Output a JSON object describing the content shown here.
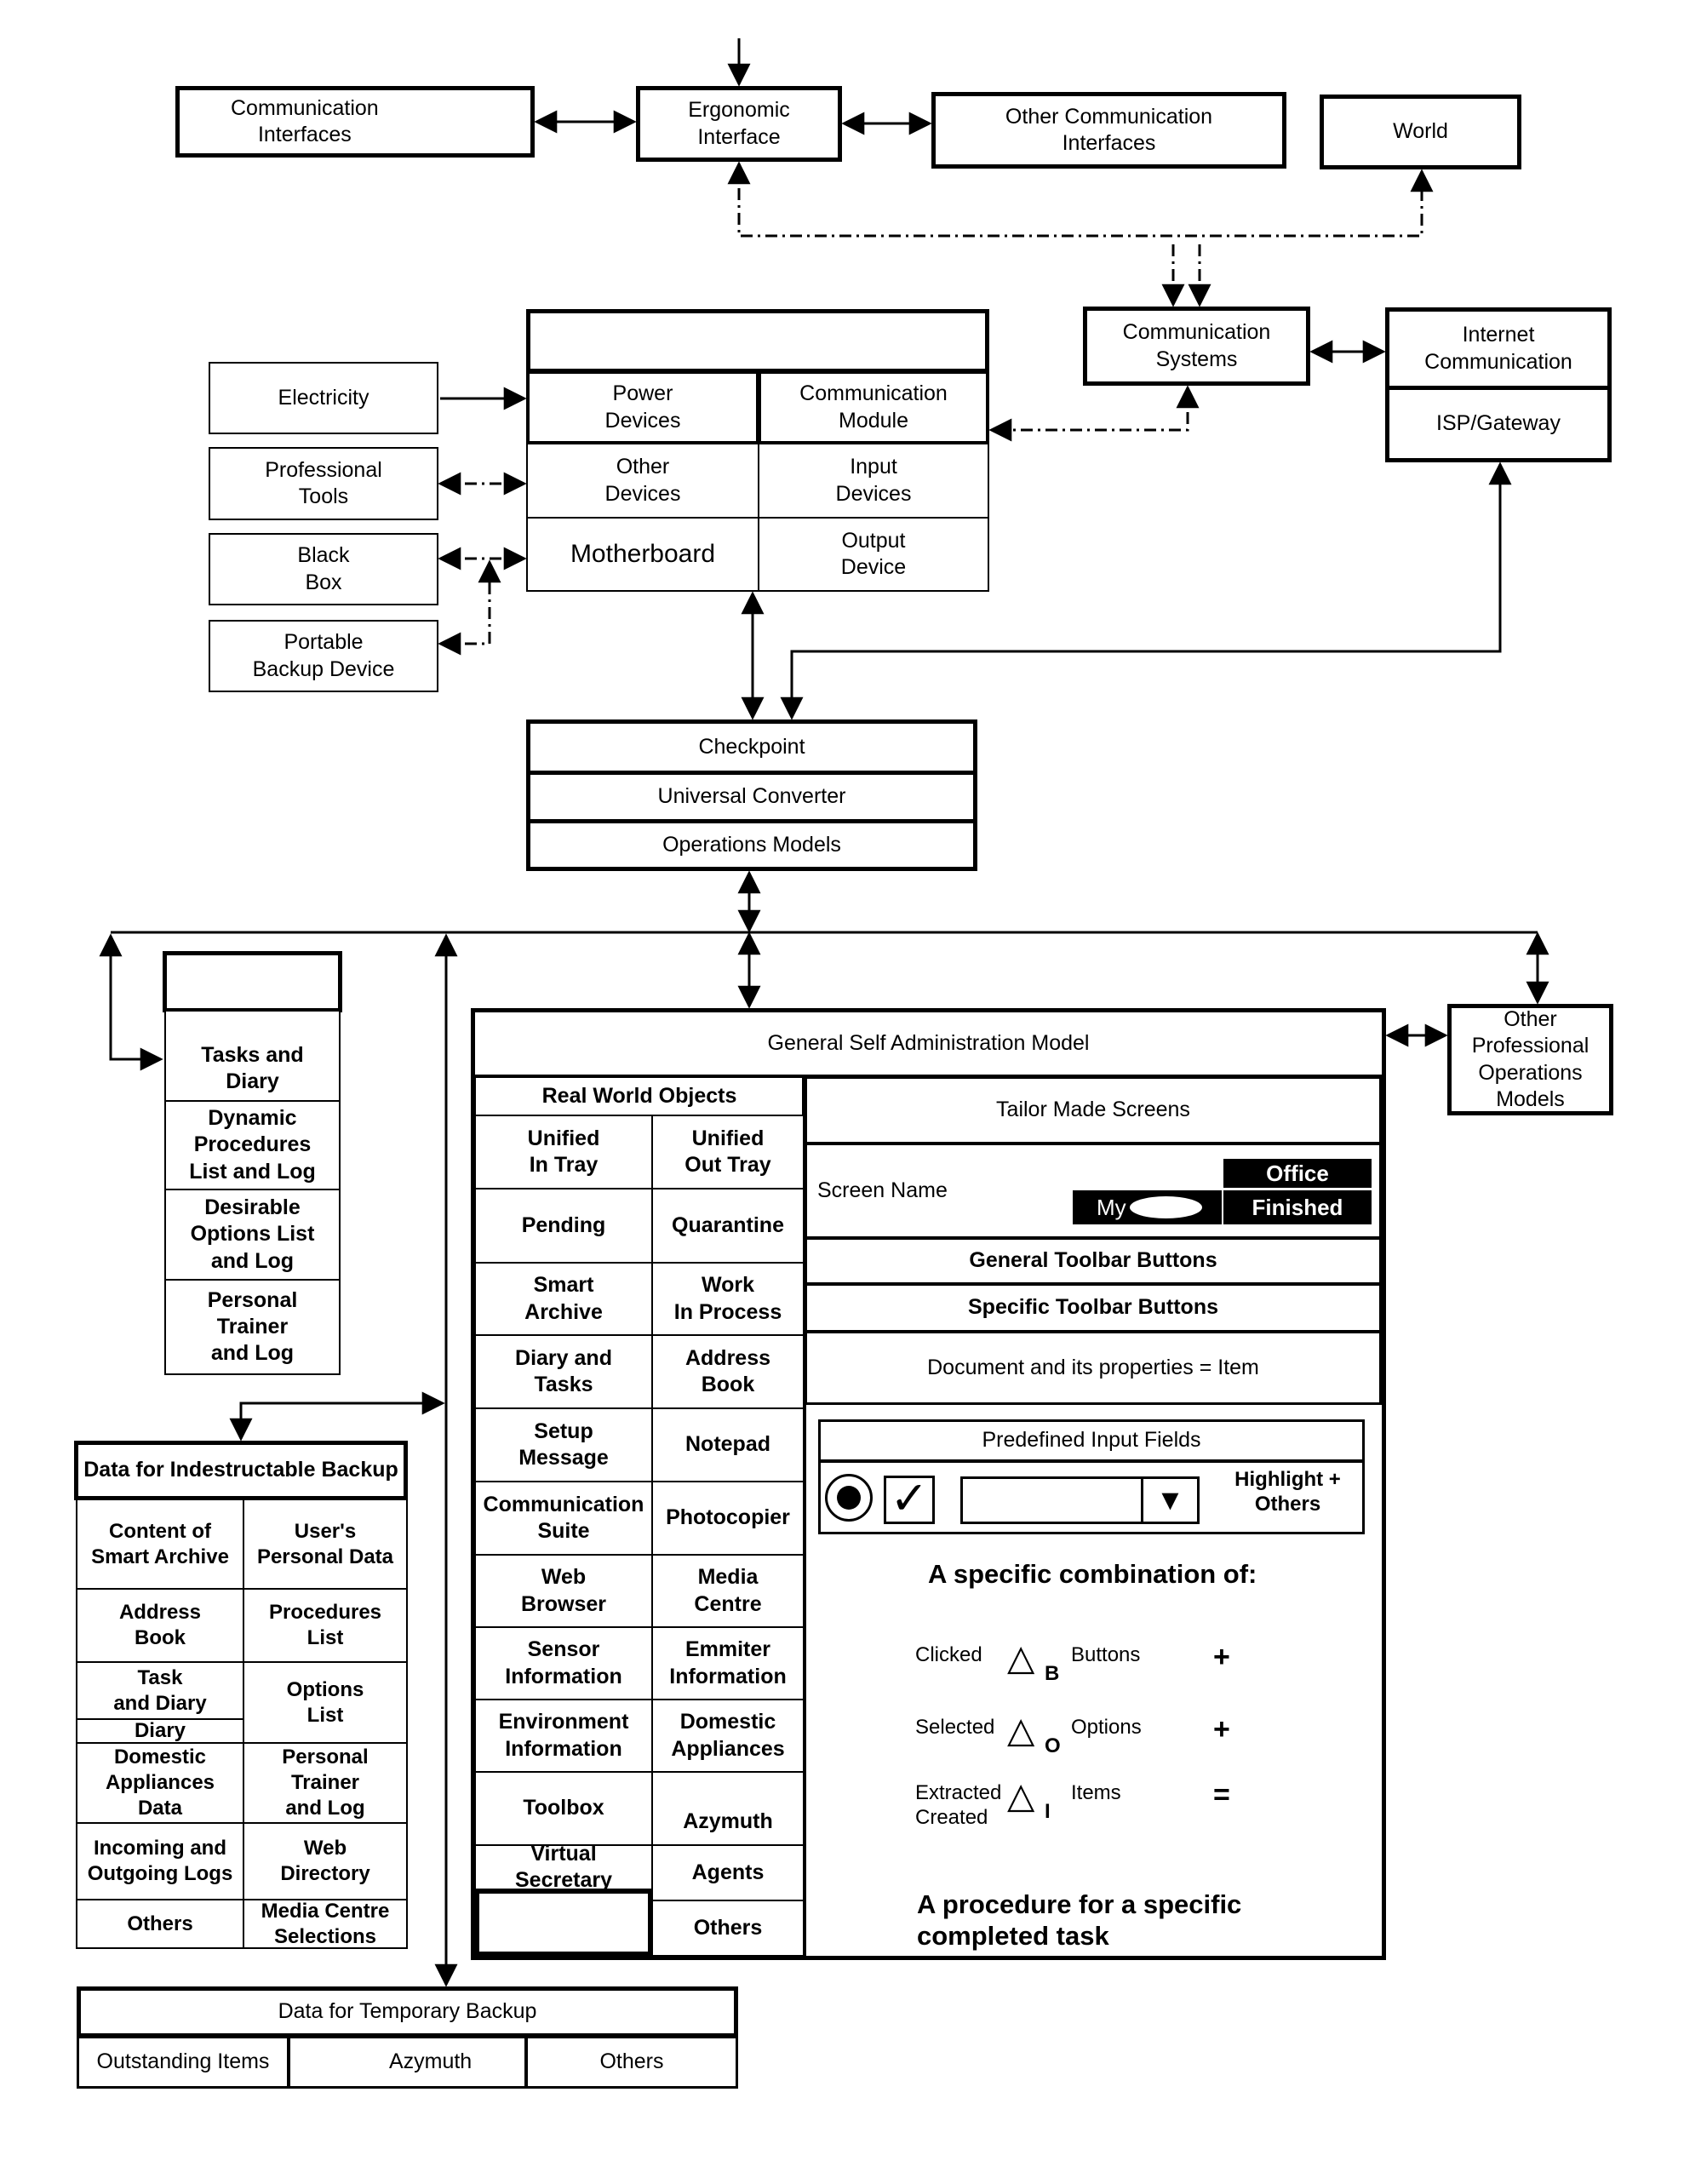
{
  "top_row": {
    "communication_interfaces": "Communication\nInterfaces",
    "ergonomic_interface": "Ergonomic\nInterface",
    "other_communication_interfaces": "Other Communication\nInterfaces",
    "world": "World"
  },
  "device_block": {
    "header": "",
    "cells": [
      "Power\nDevices",
      "Communication\nModule",
      "Other\nDevices",
      "Input\nDevices",
      "Motherboard",
      "Output\nDevice"
    ]
  },
  "peripherals": [
    "Electricity",
    "Professional\nTools",
    "Black\nBox",
    "Portable\nBackup Device"
  ],
  "communication_systems": "Communication\nSystems",
  "internet": {
    "top": "Internet\nCommunication",
    "bottom": "ISP/Gateway"
  },
  "core_stack": [
    "Checkpoint",
    "Universal Converter",
    "Operations Models"
  ],
  "tasks_list": {
    "header": "",
    "items": [
      "Tasks and\nDiary",
      "Dynamic\nProcedures\nList and Log",
      "Desirable\nOptions List\nand Log",
      "Personal\n        Trainer\nand Log"
    ]
  },
  "indestructible_backup": {
    "title": "Data for Indestructable Backup",
    "cells": [
      [
        "Content of\nSmart Archive",
        "User's\nPersonal Data"
      ],
      [
        "Address\nBook",
        "Procedures\nList"
      ],
      [
        "      Task\nand Diary",
        "Options\nList"
      ],
      [
        "Diary",
        ""
      ],
      [
        "Domestic\nAppliances\nData",
        "Personal\nTrainer\nand Log"
      ],
      [
        "Incoming and\nOutgoing Logs",
        "Web\nDirectory"
      ],
      [
        "Others",
        "Media Centre\nSelections"
      ]
    ]
  },
  "temporary_backup": {
    "title": "Data for Temporary Backup",
    "cells": [
      "Outstanding Items",
      "        Azymuth",
      "Others"
    ]
  },
  "gsam": {
    "title": "General Self Administration Model",
    "real_world_objects": {
      "header": "Real World Objects",
      "rows": [
        [
          "Unified\nIn Tray",
          "Unified\nOut Tray"
        ],
        [
          "Pending",
          "Quarantine"
        ],
        [
          "Smart\nArchive",
          "Work\nIn Process"
        ],
        [
          "Diary and\nTasks",
          "Address\nBook"
        ],
        [
          "Setup\nMessage",
          "Notepad"
        ],
        [
          "Communication\nSuite",
          "Photocopier"
        ],
        [
          "Web\nBrowser",
          "Media\nCentre"
        ],
        [
          "Sensor\nInformation",
          "Emmiter\nInformation"
        ],
        [
          "Environment\nInformation",
          "Domestic\nAppliances"
        ],
        [
          "Toolbox",
          "\nAzymuth"
        ],
        [
          "Virtual\nSecretary",
          "Agents"
        ],
        [
          "",
          "Others"
        ]
      ]
    },
    "tailor_made": {
      "header": "Tailor Made Screens",
      "screen_name_label": "Screen Name",
      "screen_buttons": [
        "Office",
        "My",
        "Finished"
      ],
      "general_toolbar": "General Toolbar Buttons",
      "specific_toolbar": "Specific Toolbar Buttons",
      "document_item": "Document and its properties = Item",
      "predefined_input_fields": "Predefined Input Fields",
      "highlight_others": "Highlight +\nOthers",
      "combination_heading": "A specific combination of:",
      "formula": [
        {
          "label": "Clicked",
          "symbol": "△",
          "sub": "B",
          "term": "Buttons",
          "op": "+"
        },
        {
          "label": "Selected",
          "symbol": "△",
          "sub": "O",
          "term": "Options",
          "op": "+"
        },
        {
          "label": "Extracted\nCreated",
          "symbol": "△",
          "sub": "I",
          "term": "Items",
          "op": "="
        }
      ],
      "procedure_text": "A procedure for a specific\ncompleted task"
    }
  },
  "other_professional_operations_models": "Other\nProfessional\nOperations\nModels"
}
